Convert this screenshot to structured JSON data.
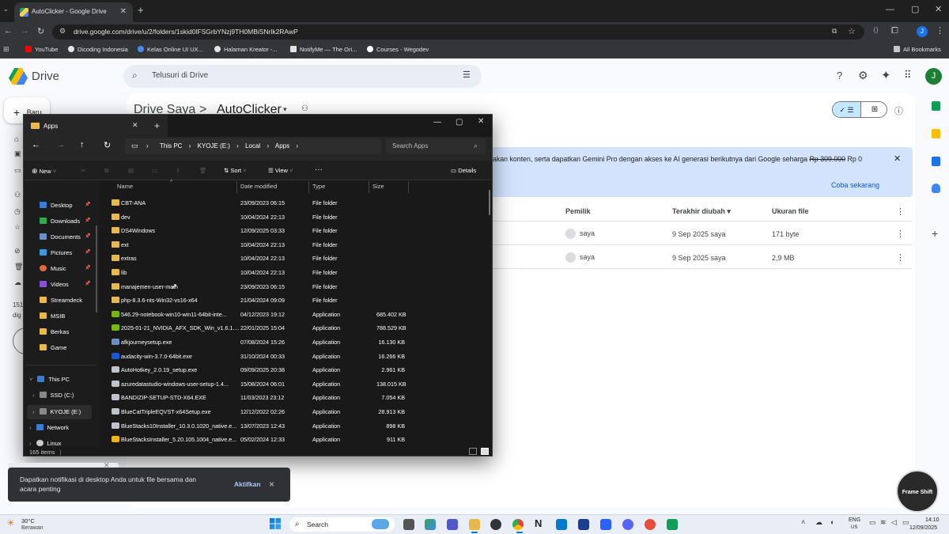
{
  "browser": {
    "tab_title": "AutoClicker - Google Drive",
    "new_tab": "+",
    "url": "drive.google.com/drive/u/2/folders/1skid0lFSGrbYNzj9TH0MBiSNrlk2RAwP",
    "profile_initial": "J",
    "bookmarks": [
      {
        "label": "YouTube",
        "color": "#ff0000"
      },
      {
        "label": "Dicoding Indonesia",
        "color": "#e3e3e3"
      },
      {
        "label": "Kelas Online UI UX...",
        "color": "#4c8bf5"
      },
      {
        "label": "Halaman Kreator -...",
        "color": "#e3e3e3"
      },
      {
        "label": "NotifyMe — The Ori...",
        "color": "#e3e3e3"
      },
      {
        "label": "Courses - Wegodev",
        "color": "#ffffff"
      }
    ],
    "all_bookmarks": "All Bookmarks"
  },
  "drive": {
    "logo_text": "Drive",
    "search_placeholder": "Telusuri di Drive",
    "new_button": "Baru",
    "breadcrumb_root": "Drive Saya",
    "breadcrumb_sep": ">",
    "breadcrumb_current": "AutoClicker",
    "banner_text": "akan konten, serta dapatkan Gemini Pro dengan akses ke AI generasi berikutnya dari Google seharga",
    "banner_old_price": "Rp 309.000",
    "banner_new_price": "Rp 0",
    "banner_cta": "Coba sekarang",
    "columns": {
      "owner": "Pemilik",
      "modified": "Terakhir diubah ▾",
      "size": "Ukuran file"
    },
    "rows": [
      {
        "owner": "saya",
        "modified": "9 Sep 2025 saya",
        "size": "171 byte"
      },
      {
        "owner": "saya",
        "modified": "9 Sep 2025 saya",
        "size": "2,9 MB"
      }
    ],
    "storage_partial_1": "151",
    "storage_partial_2": "dig"
  },
  "explorer": {
    "tab_title": "Apps",
    "path": [
      "This PC",
      "KYOJE (E:)",
      "Local",
      "Apps"
    ],
    "search_placeholder": "Search Apps",
    "commands": {
      "new": "New",
      "sort": "Sort",
      "view": "View",
      "more": "···",
      "details": "Details"
    },
    "nav": [
      {
        "label": "Desktop",
        "color": "#3a7bd5"
      },
      {
        "label": "Downloads",
        "color": "#2fa84f"
      },
      {
        "label": "Documents",
        "color": "#6b8fc7"
      },
      {
        "label": "Pictures",
        "color": "#3a9ad9"
      },
      {
        "label": "Music",
        "color": "#e0683c"
      },
      {
        "label": "Videos",
        "color": "#8a4fd6"
      },
      {
        "label": "Streamdeck",
        "color": "#e8b84b"
      },
      {
        "label": "MSIB",
        "color": "#e8b84b"
      },
      {
        "label": "Berkas",
        "color": "#e8b84b"
      },
      {
        "label": "Game",
        "color": "#e8b84b"
      },
      {
        "label": "This PC",
        "color": "#3a7bd5"
      },
      {
        "label": "SSD (C:)",
        "color": "#888888"
      },
      {
        "label": "KYOJE (E:)",
        "color": "#888888"
      },
      {
        "label": "Network",
        "color": "#3a7bd5"
      },
      {
        "label": "Linux",
        "color": "#cccccc"
      }
    ],
    "columns": {
      "name": "Name",
      "date": "Date modified",
      "type": "Type",
      "size": "Size"
    },
    "files": [
      {
        "name": "CBT-ANA",
        "date": "23/09/2023 06:15",
        "type": "File folder",
        "size": "",
        "icon": "folder"
      },
      {
        "name": "dev",
        "date": "10/04/2024 22:13",
        "type": "File folder",
        "size": "",
        "icon": "folder"
      },
      {
        "name": "DS4Windows",
        "date": "12/09/2025 03:33",
        "type": "File folder",
        "size": "",
        "icon": "folder"
      },
      {
        "name": "ext",
        "date": "10/04/2024 22:13",
        "type": "File folder",
        "size": "",
        "icon": "folder"
      },
      {
        "name": "extras",
        "date": "10/04/2024 22:13",
        "type": "File folder",
        "size": "",
        "icon": "folder"
      },
      {
        "name": "lib",
        "date": "10/04/2024 22:13",
        "type": "File folder",
        "size": "",
        "icon": "folder"
      },
      {
        "name": "manajemen-user-main",
        "date": "23/09/2023 06:15",
        "type": "File folder",
        "size": "",
        "icon": "folder"
      },
      {
        "name": "php-8.3.6-nts-Win32-vs16-x64",
        "date": "21/04/2024 09:09",
        "type": "File folder",
        "size": "",
        "icon": "folder"
      },
      {
        "name": "546.29-notebook-win10-win11-64bit-inte...",
        "date": "04/12/2023 19:12",
        "type": "Application",
        "size": "685.402 KB",
        "icon": "nvidia"
      },
      {
        "name": "2025-01-21_NVIDIA_AFX_SDK_Win_v1.6.1....",
        "date": "22/01/2025 15:04",
        "type": "Application",
        "size": "788.529 KB",
        "icon": "nvidia"
      },
      {
        "name": "afkjourneysetup.exe",
        "date": "07/08/2024 15:26",
        "type": "Application",
        "size": "16.130 KB",
        "icon": "app"
      },
      {
        "name": "audacity-win-3.7.0-64bit.exe",
        "date": "31/10/2024 00:33",
        "type": "Application",
        "size": "16.266 KB",
        "icon": "audacity"
      },
      {
        "name": "AutoHotkey_2.0.19_setup.exe",
        "date": "09/09/2025 20:38",
        "type": "Application",
        "size": "2.961 KB",
        "icon": "generic"
      },
      {
        "name": "azuredatastudio-windows-user-setup-1.4...",
        "date": "15/08/2024 06:01",
        "type": "Application",
        "size": "138.015 KB",
        "icon": "generic"
      },
      {
        "name": "BANDIZIP-SETUP-STD-X64.EXE",
        "date": "11/03/2023 23:12",
        "type": "Application",
        "size": "7.054 KB",
        "icon": "generic"
      },
      {
        "name": "BlueCatTripleEQVST-x64Setup.exe",
        "date": "12/12/2022 02:26",
        "type": "Application",
        "size": "28.913 KB",
        "icon": "generic"
      },
      {
        "name": "BlueStacks10Installer_10.3.0.1020_native.e...",
        "date": "13/07/2023 12:43",
        "type": "Application",
        "size": "898 KB",
        "icon": "generic"
      },
      {
        "name": "BlueStacksInstaller_5.20.105.1004_native.e...",
        "date": "05/02/2024 12:33",
        "type": "Application",
        "size": "911 KB",
        "icon": "bluestacks"
      }
    ],
    "item_count": "165 items"
  },
  "toast": {
    "message": "Dapatkan notifikasi di desktop Anda untuk file bersama dan acara penting",
    "action": "Aktifkan",
    "close": "×"
  },
  "watermark": {
    "text": "Frame Shift"
  },
  "taskbar": {
    "weather_temp": "30°C",
    "weather_desc": "Berawan",
    "search": "Search",
    "lang": "ENG",
    "region": "US",
    "time": "14:10",
    "date": "12/09/2025"
  }
}
